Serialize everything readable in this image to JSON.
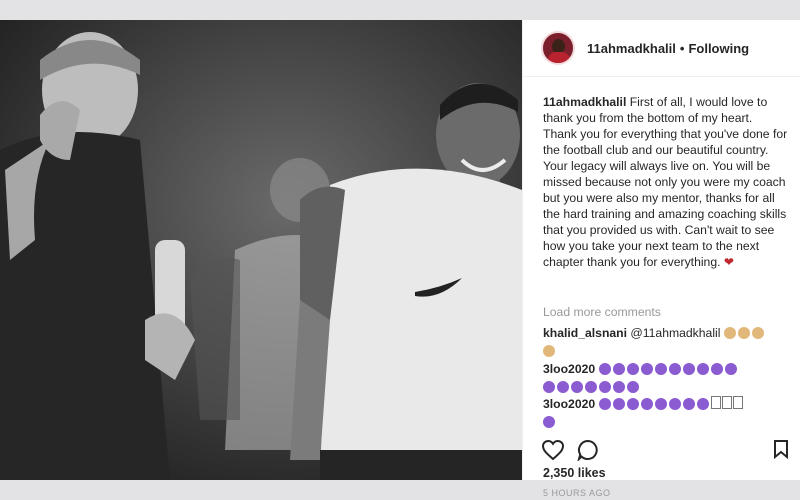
{
  "post": {
    "username": "11ahmadkhalil",
    "follow_label": "Following",
    "separator": "•",
    "caption_text": "First of all, I would love to thank you from the bottom of my heart. Thank you for everything that you've done for the football club and our beautiful country. Your legacy will always live on. You will be missed because not only you were my coach but you were also my mentor, thanks for all the hard training and amazing coaching skills that you provided us with. Can't wait to see how you take your next team to the next chapter thank you for everything.",
    "caption_heart": "❤",
    "load_more": "Load more comments",
    "likes": "2,350 likes",
    "time": "5 HOURS AGO"
  },
  "comments": [
    {
      "user": "khalid_alsnani",
      "text": "@11ahmadkhalil",
      "emoji": "clapping-hands, smiling-face, clapping-hands, clapping-hands"
    },
    {
      "user": "3loo2020",
      "text": "",
      "emoji": "purple-heart x 17"
    },
    {
      "user": "3loo2020",
      "text": "",
      "emoji": "purple-heart x 8, unknown-glyph x 3, purple-heart x 1"
    }
  ],
  "icons": [
    "heart-icon",
    "comment-icon",
    "bookmark-icon"
  ],
  "colors": {
    "heart": "#c0282f",
    "purple_heart": "#8a5bd1",
    "muted": "#999999"
  }
}
